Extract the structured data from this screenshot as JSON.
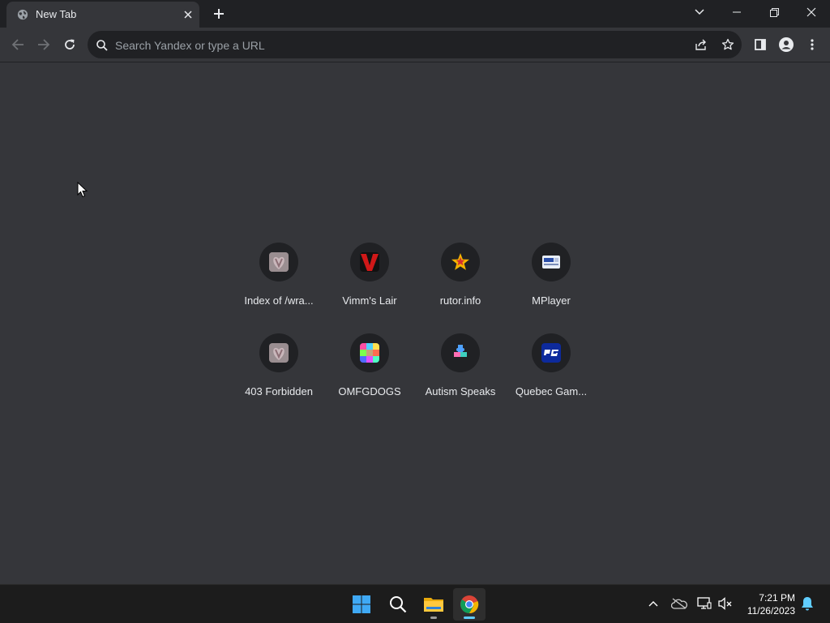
{
  "browser": {
    "tab": {
      "title": "New Tab"
    },
    "omnibox": {
      "placeholder": "Search Yandex or type a URL"
    }
  },
  "shortcuts": [
    {
      "label": "Index of /wra...",
      "icon": "heart-v-icon"
    },
    {
      "label": "Vimm's Lair",
      "icon": "vimm-v-icon"
    },
    {
      "label": "rutor.info",
      "icon": "hammer-sickle-star-icon"
    },
    {
      "label": "MPlayer",
      "icon": "mplayer-icon"
    },
    {
      "label": "403 Forbidden",
      "icon": "heart-v-icon"
    },
    {
      "label": "OMFGDOGS",
      "icon": "pixel-dogs-icon"
    },
    {
      "label": "Autism Speaks",
      "icon": "puzzle-piece-icon"
    },
    {
      "label": "Quebec Gam...",
      "icon": "qg-logo-icon"
    }
  ],
  "taskbar": {
    "apps": [
      "start-icon",
      "search-icon",
      "file-explorer-icon",
      "chrome-icon"
    ],
    "tray": [
      "chevron-up-icon",
      "onedrive-icon",
      "network-icon",
      "volume-muted-icon",
      "notification-bell-icon"
    ],
    "clock": {
      "time": "7:21 PM",
      "date": "11/26/2023"
    }
  },
  "colors": {
    "tabstrip": "#202124",
    "page": "#35363a",
    "omnibox": "#202124",
    "taskbar": "#1c1c1c",
    "accent": "#60cdff"
  }
}
